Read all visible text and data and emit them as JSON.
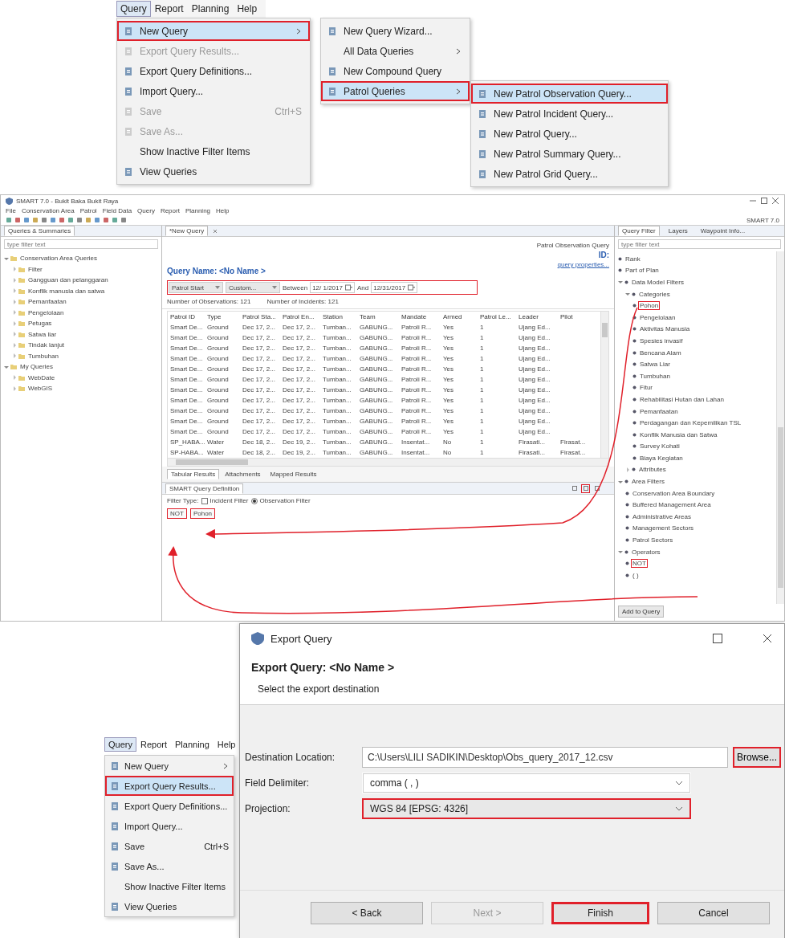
{
  "top_menu": {
    "menubar": [
      {
        "label": "Query",
        "selected": true
      },
      {
        "label": "Report",
        "selected": false
      },
      {
        "label": "Planning",
        "selected": false
      },
      {
        "label": "Help",
        "selected": false
      }
    ],
    "menu": [
      {
        "label": "New Query",
        "icon": true,
        "submenu": true,
        "selected": true,
        "highlighted": true,
        "disabled": false
      },
      {
        "label": "Export Query Results...",
        "icon": true,
        "submenu": false,
        "selected": false,
        "highlighted": false,
        "disabled": true
      },
      {
        "label": "Export Query Definitions...",
        "icon": true,
        "submenu": false,
        "selected": false,
        "highlighted": false,
        "disabled": false
      },
      {
        "label": "Import Query...",
        "icon": true,
        "submenu": false,
        "selected": false,
        "highlighted": false,
        "disabled": false
      },
      {
        "label": "Save",
        "shortcut": "Ctrl+S",
        "icon": true,
        "submenu": false,
        "selected": false,
        "highlighted": false,
        "disabled": true
      },
      {
        "label": "Save As...",
        "icon": true,
        "submenu": false,
        "selected": false,
        "highlighted": false,
        "disabled": true
      },
      {
        "label": "Show Inactive Filter Items",
        "icon": false,
        "submenu": false,
        "selected": false,
        "highlighted": false,
        "disabled": false
      },
      {
        "label": "View Queries",
        "icon": true,
        "submenu": false,
        "selected": false,
        "highlighted": false,
        "disabled": false
      }
    ],
    "submenu": [
      {
        "label": "New Query Wizard...",
        "icon": true,
        "submenu": false,
        "selected": false,
        "highlighted": false,
        "disabled": false
      },
      {
        "label": "All Data Queries",
        "icon": false,
        "submenu": true,
        "selected": false,
        "highlighted": false,
        "disabled": false
      },
      {
        "label": "New Compound Query",
        "icon": true,
        "submenu": false,
        "selected": false,
        "highlighted": false,
        "disabled": false
      },
      {
        "label": "Patrol Queries",
        "icon": true,
        "submenu": true,
        "selected": true,
        "highlighted": true,
        "disabled": false
      }
    ],
    "subsubmenu": [
      {
        "label": "New Patrol Observation Query...",
        "icon": true,
        "submenu": false,
        "selected": true,
        "highlighted": true,
        "disabled": false
      },
      {
        "label": "New Patrol Incident Query...",
        "icon": true,
        "submenu": false,
        "selected": false,
        "highlighted": false,
        "disabled": false
      },
      {
        "label": "New Patrol Query...",
        "icon": true,
        "submenu": false,
        "selected": false,
        "highlighted": false,
        "disabled": false
      },
      {
        "label": "New Patrol Summary Query...",
        "icon": true,
        "submenu": false,
        "selected": false,
        "highlighted": false,
        "disabled": false
      },
      {
        "label": "New Patrol Grid Query...",
        "icon": true,
        "submenu": false,
        "selected": false,
        "highlighted": false,
        "disabled": false
      }
    ]
  },
  "app": {
    "title": "SMART 7.0 - Bukit Baka Bukit Raya",
    "perspective": "SMART 7.0",
    "menubar": [
      "File",
      "Conservation Area",
      "Patrol",
      "Field Data",
      "Query",
      "Report",
      "Planning",
      "Help"
    ],
    "left_panel": {
      "tab": "Queries & Summaries",
      "filter_placeholder": "type filter text",
      "tree": [
        {
          "label": "Conservation Area Queries",
          "expanded": true,
          "children": [
            {
              "label": "Filter",
              "expanded": false
            },
            {
              "label": "Gangguan dan pelanggaran",
              "expanded": false
            },
            {
              "label": "Konflik manusia dan satwa",
              "expanded": false
            },
            {
              "label": "Pemanfaatan",
              "expanded": false
            },
            {
              "label": "Pengelolaan",
              "expanded": false
            },
            {
              "label": "Petugas",
              "expanded": false
            },
            {
              "label": "Satwa liar",
              "expanded": false
            },
            {
              "label": "Tindak lanjut",
              "expanded": false
            },
            {
              "label": "Tumbuhan",
              "expanded": false
            }
          ]
        },
        {
          "label": "My Queries",
          "expanded": true,
          "children": [
            {
              "label": "WebDate",
              "expanded": false
            },
            {
              "label": "WebGIS",
              "expanded": false
            }
          ]
        }
      ]
    },
    "editor": {
      "tab": "*New Query",
      "query_type": "Patrol Observation Query",
      "query_name": "Query Name: <No Name >",
      "id_label": "ID:",
      "properties_link": "query properties...",
      "filter_bar": {
        "highlighted": true,
        "field": "Patrol Start",
        "range": "Custom...",
        "between": "Between",
        "from": "12/ 1/2017",
        "and": "And",
        "to": "12/31/2017"
      },
      "counts": [
        "Number of Observations: 121",
        "Number of Incidents: 121"
      ],
      "table": {
        "columns": [
          "Patrol ID",
          "Type",
          "Patrol Sta...",
          "Patrol En...",
          "Station",
          "Team",
          "Mandate",
          "Armed",
          "Patrol Le...",
          "Leader",
          "Pilot"
        ],
        "rows": [
          [
            "Smart De...",
            "Ground",
            "Dec 17, 2...",
            "Dec 17, 2...",
            "Tumban...",
            "GABUNG...",
            "Patroli R...",
            "Yes",
            "1",
            "Ujang Ed..."
          ],
          [
            "Smart De...",
            "Ground",
            "Dec 17, 2...",
            "Dec 17, 2...",
            "Tumban...",
            "GABUNG...",
            "Patroli R...",
            "Yes",
            "1",
            "Ujang Ed..."
          ],
          [
            "Smart De...",
            "Ground",
            "Dec 17, 2...",
            "Dec 17, 2...",
            "Tumban...",
            "GABUNG...",
            "Patroli R...",
            "Yes",
            "1",
            "Ujang Ed..."
          ],
          [
            "Smart De...",
            "Ground",
            "Dec 17, 2...",
            "Dec 17, 2...",
            "Tumban...",
            "GABUNG...",
            "Patroli R...",
            "Yes",
            "1",
            "Ujang Ed..."
          ],
          [
            "Smart De...",
            "Ground",
            "Dec 17, 2...",
            "Dec 17, 2...",
            "Tumban...",
            "GABUNG...",
            "Patroli R...",
            "Yes",
            "1",
            "Ujang Ed..."
          ],
          [
            "Smart De...",
            "Ground",
            "Dec 17, 2...",
            "Dec 17, 2...",
            "Tumban...",
            "GABUNG...",
            "Patroli R...",
            "Yes",
            "1",
            "Ujang Ed..."
          ],
          [
            "Smart De...",
            "Ground",
            "Dec 17, 2...",
            "Dec 17, 2...",
            "Tumban...",
            "GABUNG...",
            "Patroli R...",
            "Yes",
            "1",
            "Ujang Ed..."
          ],
          [
            "Smart De...",
            "Ground",
            "Dec 17, 2...",
            "Dec 17, 2...",
            "Tumban...",
            "GABUNG...",
            "Patroli R...",
            "Yes",
            "1",
            "Ujang Ed..."
          ],
          [
            "Smart De...",
            "Ground",
            "Dec 17, 2...",
            "Dec 17, 2...",
            "Tumban...",
            "GABUNG...",
            "Patroli R...",
            "Yes",
            "1",
            "Ujang Ed..."
          ],
          [
            "Smart De...",
            "Ground",
            "Dec 17, 2...",
            "Dec 17, 2...",
            "Tumban...",
            "GABUNG...",
            "Patroli R...",
            "Yes",
            "1",
            "Ujang Ed..."
          ],
          [
            "Smart De...",
            "Ground",
            "Dec 17, 2...",
            "Dec 17, 2...",
            "Tumban...",
            "GABUNG...",
            "Patroli R...",
            "Yes",
            "1",
            "Ujang Ed..."
          ],
          [
            "SP_HABA...",
            "Water",
            "Dec 18, 2...",
            "Dec 19, 2...",
            "Tumban...",
            "GABUNG...",
            "Insentat...",
            "No",
            "1",
            "Firasati...",
            "Firasat..."
          ],
          [
            "SP-HABA...",
            "Water",
            "Dec 18, 2...",
            "Dec 19, 2...",
            "Tumban...",
            "GABUNG...",
            "Insentat...",
            "No",
            "1",
            "Firasati...",
            "Firasat..."
          ]
        ]
      },
      "result_tabs": [
        {
          "label": "Tabular Results",
          "selected": true
        },
        {
          "label": "Attachments",
          "selected": false
        },
        {
          "label": "Mapped Results",
          "selected": false
        }
      ]
    },
    "definition": {
      "tab": "SMART Query Definition",
      "toolbar": [
        {
          "highlighted": false
        },
        {
          "highlighted": true
        },
        {
          "highlighted": false
        }
      ],
      "filter_type": "Filter Type:",
      "options": [
        {
          "kind": "checkbox",
          "label": "Incident Filter",
          "checked": false
        },
        {
          "kind": "radio",
          "label": "Observation Filter",
          "checked": true
        }
      ],
      "terms": [
        {
          "label": "NOT",
          "highlighted": true
        },
        {
          "label": "Pohon",
          "highlighted": true
        }
      ]
    },
    "right_panel": {
      "tabs": [
        {
          "label": "Query Filter",
          "selected": true
        },
        {
          "label": "Layers",
          "selected": false
        },
        {
          "label": "Waypoint Info...",
          "selected": false
        }
      ],
      "filter_placeholder": "type filter text",
      "tree": [
        {
          "label": "Rank",
          "highlighted": false
        },
        {
          "label": "Part of Plan",
          "highlighted": false
        },
        {
          "label": "Data Model Filters",
          "expanded": true,
          "highlighted": false,
          "children": [
            {
              "label": "Categories",
              "expanded": true,
              "highlighted": false,
              "children": [
                {
                  "label": "Pohon",
                  "highlighted": true
                },
                {
                  "label": "Pengelolaan",
                  "highlighted": false
                },
                {
                  "label": "Aktivitas Manusia",
                  "highlighted": false
                },
                {
                  "label": "Spesies invasif",
                  "highlighted": false
                },
                {
                  "label": "Bencana Alam",
                  "highlighted": false
                },
                {
                  "label": "Satwa Liar",
                  "highlighted": false
                },
                {
                  "label": "Tumbuhan",
                  "highlighted": false
                },
                {
                  "label": "Fitur",
                  "highlighted": false
                },
                {
                  "label": "Rehabilitasi Hutan dan Lahan",
                  "highlighted": false
                },
                {
                  "label": "Pemanfaatan",
                  "highlighted": false
                },
                {
                  "label": "Perdagangan dan Kepemilikan TSL",
                  "highlighted": false
                },
                {
                  "label": "Konflik Manusia dan Satwa",
                  "highlighted": false
                },
                {
                  "label": "Survey Kohati",
                  "highlighted": false
                },
                {
                  "label": "Biaya Kegiatan",
                  "highlighted": false
                }
              ]
            },
            {
              "label": "Attributes",
              "expanded": false,
              "highlighted": false
            }
          ]
        },
        {
          "label": "Area Filters",
          "expanded": true,
          "highlighted": false,
          "children": [
            {
              "label": "Conservation Area Boundary",
              "highlighted": false
            },
            {
              "label": "Buffered Management Area",
              "highlighted": false
            },
            {
              "label": "Administrative Areas",
              "highlighted": false
            },
            {
              "label": "Management Sectors",
              "highlighted": false
            },
            {
              "label": "Patrol Sectors",
              "highlighted": false
            }
          ]
        },
        {
          "label": "Operators",
          "expanded": true,
          "highlighted": false,
          "children": [
            {
              "label": "NOT",
              "highlighted": true
            },
            {
              "label": "( )",
              "highlighted": false
            }
          ]
        }
      ],
      "button": "Add to Query"
    }
  },
  "export": {
    "menubar": [
      {
        "label": "Query",
        "selected": true
      },
      {
        "label": "Report",
        "selected": false
      },
      {
        "label": "Planning",
        "selected": false
      },
      {
        "label": "Help",
        "selected": false
      }
    ],
    "menu": [
      {
        "label": "New Query",
        "icon": true,
        "submenu": true,
        "selected": false,
        "highlighted": false,
        "disabled": false
      },
      {
        "label": "Export Query Results...",
        "icon": true,
        "submenu": false,
        "selected": true,
        "highlighted": true,
        "disabled": false
      },
      {
        "label": "Export Query Definitions...",
        "icon": true,
        "submenu": false,
        "selected": false,
        "highlighted": false,
        "disabled": false
      },
      {
        "label": "Import Query...",
        "icon": true,
        "submenu": false,
        "selected": false,
        "highlighted": false,
        "disabled": false
      },
      {
        "label": "Save",
        "shortcut": "Ctrl+S",
        "icon": true,
        "submenu": false,
        "selected": false,
        "highlighted": false,
        "disabled": false
      },
      {
        "label": "Save As...",
        "icon": true,
        "submenu": false,
        "selected": false,
        "highlighted": false,
        "disabled": false
      },
      {
        "label": "Show Inactive Filter Items",
        "icon": false,
        "submenu": false,
        "selected": false,
        "highlighted": false,
        "disabled": false
      },
      {
        "label": "View Queries",
        "icon": true,
        "submenu": false,
        "selected": false,
        "highlighted": false,
        "disabled": false
      }
    ],
    "dialog": {
      "title": "Export Query",
      "heading": "Export Query: <No Name >",
      "subheading": "Select the export destination",
      "fields": [
        {
          "kind": "text",
          "label": "Destination Location:",
          "value": "C:\\Users\\LILI SADIKIN\\Desktop\\Obs_query_2017_12.csv",
          "highlighted": false,
          "button": {
            "label": "Browse...",
            "highlighted": true
          }
        },
        {
          "kind": "dropdown",
          "label": "Field Delimiter:",
          "value": "comma ( , )",
          "highlighted": false
        },
        {
          "kind": "dropdown",
          "label": "Projection:",
          "value": "WGS 84 [EPSG: 4326]",
          "highlighted": true
        }
      ],
      "buttons": [
        {
          "label": "< Back",
          "disabled": false,
          "highlighted": false
        },
        {
          "label": "Next >",
          "disabled": true,
          "highlighted": false
        },
        {
          "label": "Finish",
          "disabled": false,
          "highlighted": true
        },
        {
          "label": "Cancel",
          "disabled": false,
          "highlighted": false
        }
      ]
    }
  }
}
